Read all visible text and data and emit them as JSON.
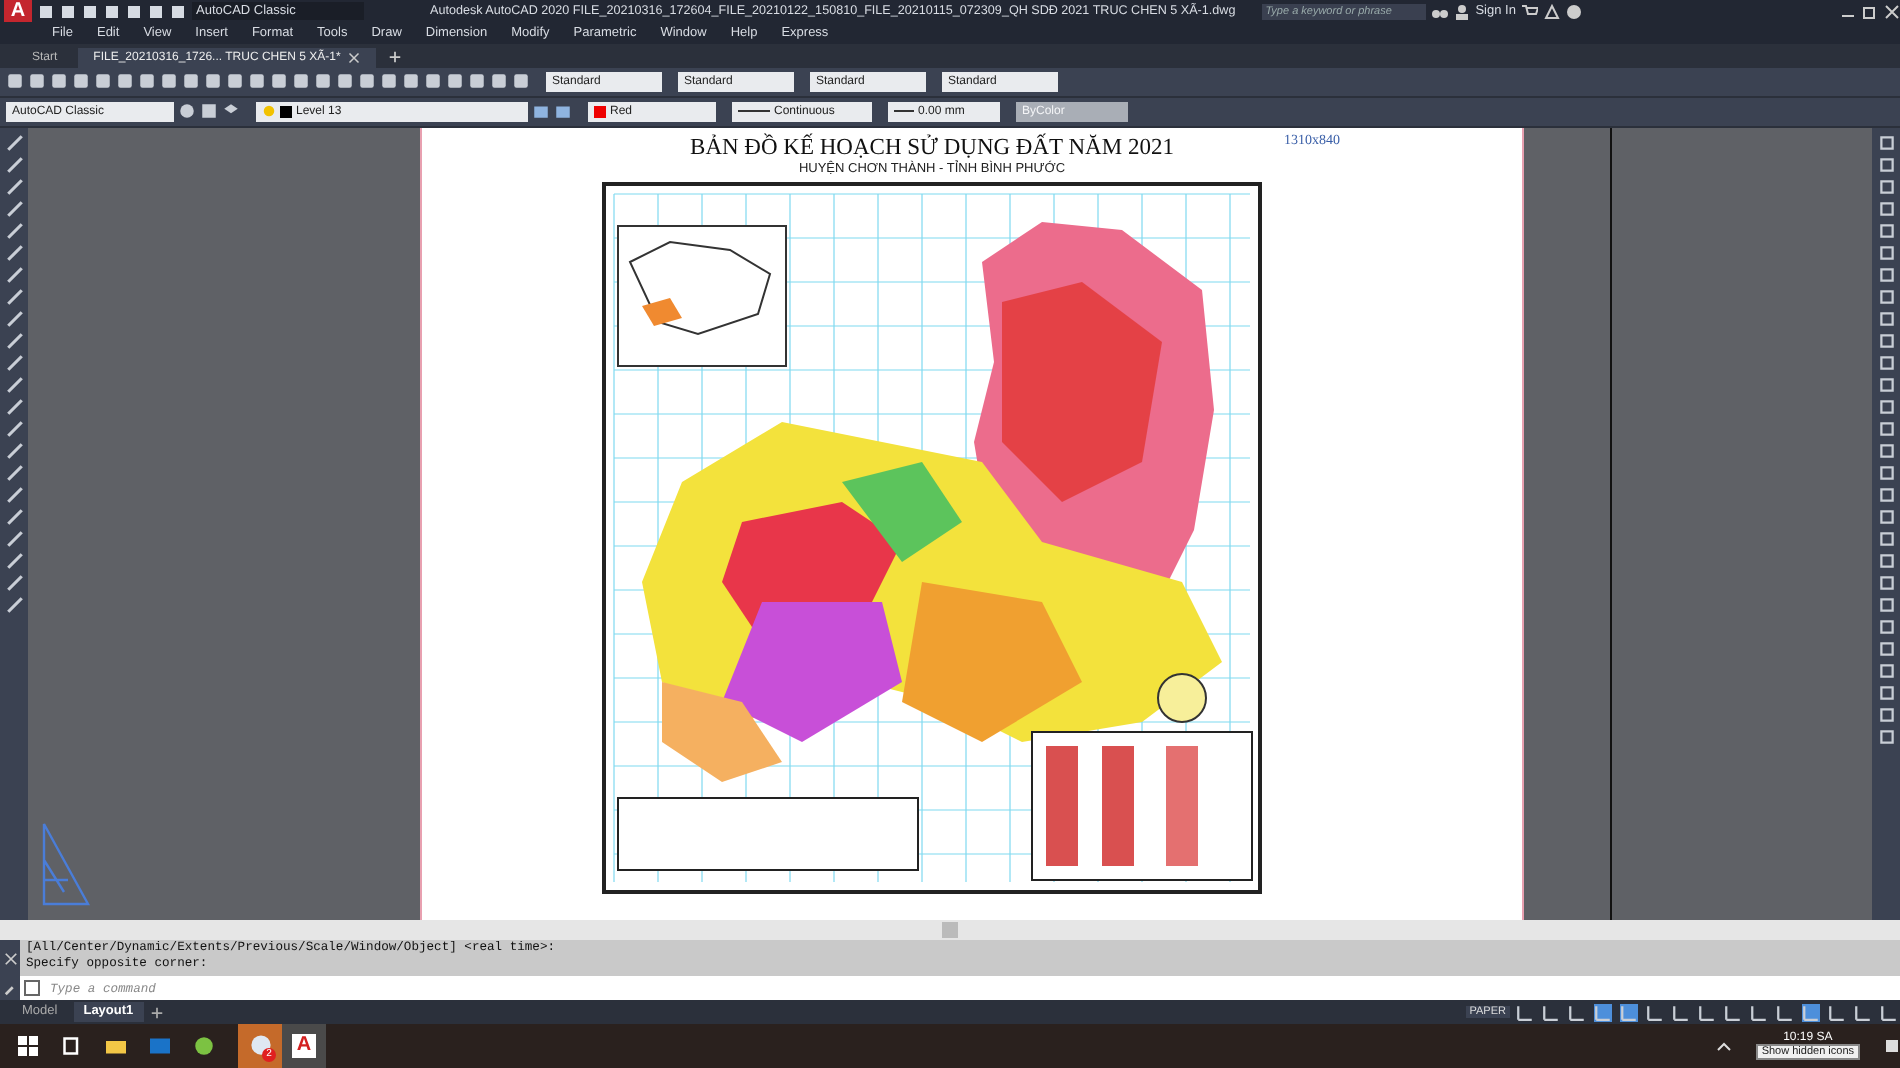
{
  "title_bar": {
    "logo": "A",
    "workspace": "AutoCAD Classic",
    "title": "Autodesk AutoCAD 2020  FILE_20210316_172604_FILE_20210122_150810_FILE_20210115_072309_QH SDĐ 2021 TRUC CHEN 5 XÃ-1.dwg",
    "search": {
      "placeholder": "Type a keyword or phrase"
    },
    "sign_in": "Sign In"
  },
  "menu": [
    "File",
    "Edit",
    "View",
    "Insert",
    "Format",
    "Tools",
    "Draw",
    "Dimension",
    "Modify",
    "Parametric",
    "Window",
    "Help",
    "Express"
  ],
  "file_tabs": [
    {
      "label": "Start",
      "selected": false
    },
    {
      "label": "FILE_20210316_1726... TRUC CHEN 5 XÃ-1*",
      "selected": true
    }
  ],
  "toolbar_1": {
    "dropdowns": [
      "Standard",
      "Standard",
      "Standard",
      "Standard"
    ]
  },
  "toolbar_2": {
    "workspace": "AutoCAD Classic",
    "layer": "Level 13",
    "color_label": "Red",
    "linetype": "Continuous",
    "lineweight": "0.00 mm",
    "plot_style": {
      "label": "ByColor",
      "disabled": true
    }
  },
  "drawing": {
    "title": "BẢN ĐỒ KẾ HOẠCH SỬ DỤNG ĐẤT NĂM 2021",
    "subtitle": "HUYỆN CHƠN THÀNH - TỈNH BÌNH PHƯỚC",
    "size_note": "1310x840"
  },
  "command": {
    "history": [
      "[All/Center/Dynamic/Extents/Previous/Scale/Window/Object] <real time>:",
      "Specify opposite corner:"
    ],
    "placeholder": "Type a command"
  },
  "layout_tabs": [
    {
      "label": "Model",
      "selected": false
    },
    {
      "label": "Layout1",
      "selected": true
    }
  ],
  "status_bar": {
    "space": "PAPER",
    "toggles": [
      {
        "on": false
      },
      {
        "on": false
      },
      {
        "on": false
      },
      {
        "on": true
      },
      {
        "on": true
      },
      {
        "on": false
      },
      {
        "on": false
      },
      {
        "on": false
      },
      {
        "on": false
      },
      {
        "on": false
      },
      {
        "on": false
      },
      {
        "on": true
      },
      {
        "on": false
      },
      {
        "on": false
      },
      {
        "on": false
      }
    ]
  },
  "taskbar": {
    "badge": "2",
    "app_logo": "A",
    "time": "10:19 SA",
    "tooltip": "Show hidden icons"
  }
}
